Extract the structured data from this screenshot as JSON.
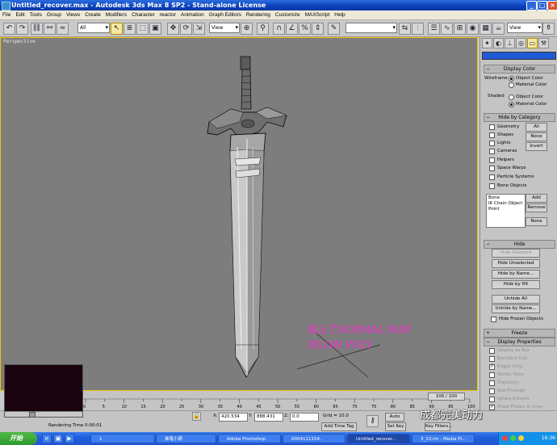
{
  "window": {
    "title": "Untitled_recover.max - Autodesk 3ds Max 8 SP2 - Stand-alone License",
    "minimize": "_",
    "maximize": "□",
    "close": "×"
  },
  "menu": [
    "File",
    "Edit",
    "Tools",
    "Group",
    "Views",
    "Create",
    "Modifiers",
    "Character",
    "reactor",
    "Animation",
    "Graph Editors",
    "Rendering",
    "Customize",
    "MAXScript",
    "Help"
  ],
  "toolbar": {
    "selection_filter": "All",
    "ref_coord": "View",
    "named_selection": "",
    "view_dropdown": "View"
  },
  "viewport": {
    "label": "Perspective",
    "annotation_line1": "贴上了NORMAL MAP",
    "annotation_line2": "的LOW POLY"
  },
  "command_panel": {
    "display_color": {
      "title": "Display Color",
      "wireframe_label": "Wireframe",
      "shaded_label": "Shaded",
      "object_color": "Object Color",
      "material_color": "Material Color"
    },
    "hide_by_category": {
      "title": "Hide by Category",
      "items": [
        "Geometry",
        "Shapes",
        "Lights",
        "Cameras",
        "Helpers",
        "Space Warps",
        "Particle Systems",
        "Bone Objects"
      ],
      "btn_all": "All",
      "btn_none": "None",
      "btn_invert": "Invert",
      "list": [
        "Bone",
        "IK Chain Object",
        "Point"
      ],
      "btn_add": "Add",
      "btn_remove": "Remove",
      "btn_none2": "None"
    },
    "hide": {
      "title": "Hide",
      "hide_selected": "Hide Selected",
      "hide_unselected": "Hide Unselected",
      "hide_by_name": "Hide by Name...",
      "hide_by_hit": "Hide by Hit",
      "unhide_all": "Unhide All",
      "unhide_by_name": "Unhide by Name...",
      "hide_frozen": "Hide Frozen Objects"
    },
    "freeze": {
      "title": "Freeze"
    },
    "display_properties": {
      "title": "Display Properties",
      "items": [
        "Display as Box",
        "Backface Cull",
        "Edges Only",
        "Vertex Ticks",
        "Trajectory",
        "See-Through",
        "Ignore Extents",
        "Show Frozen in Gray"
      ]
    }
  },
  "timeline": {
    "frame_display": "100 / 100",
    "ticks": [
      "0",
      "5",
      "10",
      "15",
      "20",
      "25",
      "30",
      "35",
      "40",
      "45",
      "50",
      "55",
      "60",
      "65",
      "70",
      "75",
      "80",
      "85",
      "90",
      "95",
      "100"
    ]
  },
  "status": {
    "x_label": "X:",
    "x_value": "420.534",
    "y_label": "Y:",
    "y_value": "888.431",
    "z_label": "Z:",
    "z_value": "0.0",
    "grid": "Grid = 10.0",
    "add_time_tag": "Add Time Tag",
    "rendering_time": "Rendering Time  0:00:01",
    "auto_key": "Auto",
    "set_key": "Set Key",
    "key_filters": "Key Filters..."
  },
  "taskbar": {
    "start": "开始",
    "tasks": [
      "1",
      "谁笔小葫",
      "Adobe Photoshop",
      "0004111154..",
      "Untitled_recover...",
      "3_13.rm - Media Pl..."
    ],
    "clock": "16:36"
  },
  "watermark": "成都完美动力",
  "colors": {
    "viewport_bg": "#7d7d7d",
    "viewport_border": "#f3c400",
    "annotation": "#ff2ad4",
    "titlebar": "#0a3fb8",
    "taskbar": "#2256d2"
  }
}
